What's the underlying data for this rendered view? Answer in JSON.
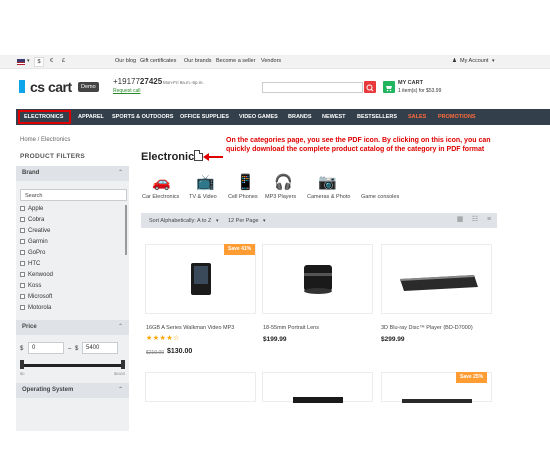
{
  "topbar": {
    "currency_symbols": [
      "$",
      "€",
      "£"
    ],
    "links": [
      "Our blog",
      "Gift certificates",
      "Our brands",
      "Become a seller",
      "Vendors"
    ],
    "account": "My Account"
  },
  "header": {
    "logo_text": "cs cart",
    "demo_badge": "Demo",
    "phone_prefix": "+19177",
    "phone_bold": "27425",
    "hours": "Mon-Fri 9a.m.-6p.m.",
    "request_call": "Request call",
    "cart_title": "MY CART",
    "cart_sub": "1 item(s) for $53.99"
  },
  "nav": {
    "items": [
      "ELECTRONICS",
      "APPAREL",
      "SPORTS & OUTDOORS",
      "OFFICE SUPPLIES",
      "VIDEO GAMES",
      "BRANDS",
      "NEWEST",
      "BESTSELLERS",
      "SALES",
      "PROMOTIONS"
    ],
    "highlight_color": "#ff6a3d"
  },
  "breadcrumb": "Home  /  Electronics",
  "sidebar": {
    "filters_title": "PRODUCT FILTERS",
    "brand_title": "Brand",
    "brand_search": "Search",
    "brands": [
      "Apple",
      "Cobra",
      "Creative",
      "Garmin",
      "GoPro",
      "HTC",
      "Kenwood",
      "Koss",
      "Microsoft",
      "Motorola"
    ],
    "price_title": "Price",
    "price_currency": "$",
    "price_from": "0",
    "price_dash": "–",
    "price_to": "5400",
    "slider_lo": "$0",
    "slider_hi": "$5400",
    "os_title": "Operating System"
  },
  "main": {
    "title": "Electronics",
    "annotation": "On the categories page, you see the PDF icon. By clicking on this icon, you can quickly download the complete product catalog of the category in PDF format",
    "categories": [
      "Car Electronics",
      "TV & Video",
      "Cell Phones",
      "MP3 Players",
      "Cameras & Photo",
      "Game consoles"
    ],
    "sort_label": "Sort Alphabetically: A to Z",
    "perpage_label": "12 Per Page"
  },
  "products": [
    {
      "name": "16GB A Series Walkman Video MP3",
      "old_price": "$219.00",
      "price": "$130.00",
      "discount": "Save 41%",
      "stars": "★★★★☆"
    },
    {
      "name": "18-55mm Portrait Lens",
      "price": "$199.99"
    },
    {
      "name": "3D Blu-ray Disc™ Player (BD-D7000)",
      "price": "$299.99"
    }
  ],
  "second_row_discount": "Save 25%"
}
